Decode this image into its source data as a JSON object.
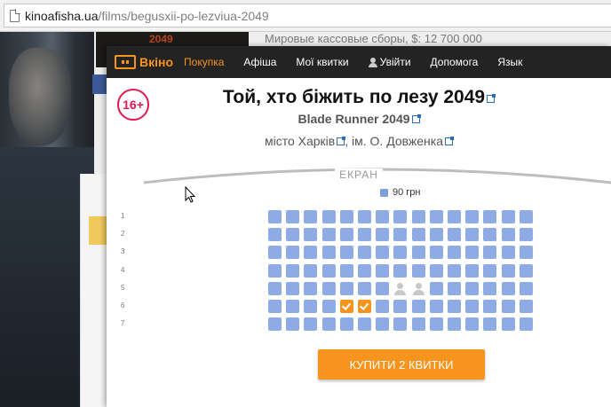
{
  "browser": {
    "url_domain": "kinoafisha.ua",
    "url_path": "/films/begusxii-po-lezviua-2049"
  },
  "background": {
    "poster_text": "2049",
    "box_office_text": "Мировые кассовые сборы, $: 12 700 000"
  },
  "nav": {
    "logo": "Вкіно",
    "items": [
      {
        "label": "Покупка",
        "active": true
      },
      {
        "label": "Афіша",
        "active": false
      },
      {
        "label": "Мої квитки",
        "active": false
      },
      {
        "label": "Увійти",
        "active": false,
        "icon": "user-icon"
      },
      {
        "label": "Допомога",
        "active": false
      },
      {
        "label": "Язык",
        "active": false
      }
    ]
  },
  "age_rating": "16+",
  "movie": {
    "title": "Той, хто біжить по лезу 2049",
    "original_title": "Blade Runner 2049"
  },
  "venue": {
    "city": "місто Харків",
    "cinema": "ім. О. Довженка",
    "separator": ", "
  },
  "hall": {
    "screen_label": "ЕКРАН",
    "legend_price": "90 грн",
    "seat_color": "#8fabe6",
    "selected_color": "#f7941d",
    "rows": [
      {
        "label": "1",
        "seats": [
          "a",
          "a",
          "a",
          "a",
          "a",
          "a",
          "a",
          "a",
          "a",
          "a",
          "a",
          "a",
          "a",
          "a",
          "a"
        ]
      },
      {
        "label": "2",
        "seats": [
          "a",
          "a",
          "a",
          "a",
          "a",
          "a",
          "a",
          "a",
          "a",
          "a",
          "a",
          "a",
          "a",
          "a",
          "a"
        ]
      },
      {
        "label": "3",
        "seats": [
          "a",
          "a",
          "a",
          "a",
          "a",
          "a",
          "a",
          "a",
          "a",
          "a",
          "a",
          "a",
          "a",
          "a",
          "a"
        ]
      },
      {
        "label": "4",
        "seats": [
          "a",
          "a",
          "a",
          "a",
          "a",
          "a",
          "a",
          "a",
          "a",
          "a",
          "a",
          "a",
          "a",
          "a",
          "a"
        ]
      },
      {
        "label": "5",
        "seats": [
          "a",
          "a",
          "a",
          "a",
          "a",
          "a",
          "a",
          "o",
          "o",
          "a",
          "a",
          "a",
          "a",
          "a",
          "a"
        ]
      },
      {
        "label": "6",
        "seats": [
          "a",
          "a",
          "a",
          "a",
          "s",
          "s",
          "a",
          "a",
          "a",
          "a",
          "a",
          "a",
          "a",
          "a",
          "a"
        ]
      },
      {
        "label": "7",
        "seats": [
          "a",
          "a",
          "a",
          "a",
          "a",
          "a",
          "a",
          "a",
          "a",
          "a",
          "a",
          "a",
          "a",
          "a",
          "a"
        ]
      }
    ]
  },
  "buy_button": "КУПИТИ 2 КВИТКИ"
}
